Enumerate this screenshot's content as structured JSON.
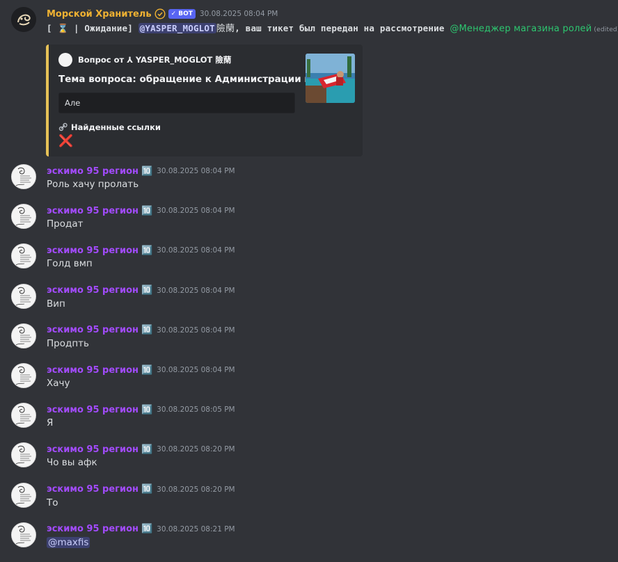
{
  "bot_message": {
    "author": "Морской Хранитель",
    "bot_tag": "BOT",
    "timestamp": "30.08.2025 08:04 PM",
    "content_prefix": "[",
    "content_emoji": "⌛",
    "content_status": " | Ожидание]",
    "user_mention": "@YASPER_MOGLOT",
    "user_suffix": "險䔵",
    "content_text": ", ваш тикет был передан на рассмотрение",
    "role_mention": "@Менеджер магазина ролей",
    "edited": "(edited)",
    "embed": {
      "author": "Вопрос от ⅄ YASPER_MOGLOT 險䔵",
      "title": "Тема вопроса: обращение к Администрации магазина",
      "field_value": "Але",
      "links_title": "Найденные ссылки",
      "links_value": "❌",
      "accent_color": "#e6c157"
    }
  },
  "user": {
    "name": "эскимо 95 регион",
    "role_icon": "🔟",
    "name_color": "#a34bff"
  },
  "messages": [
    {
      "timestamp": "30.08.2025 08:04 PM",
      "text": "Роль хачу пролать"
    },
    {
      "timestamp": "30.08.2025 08:04 PM",
      "text": "Продат"
    },
    {
      "timestamp": "30.08.2025 08:04 PM",
      "text": "Голд вмп"
    },
    {
      "timestamp": "30.08.2025 08:04 PM",
      "text": "Вип"
    },
    {
      "timestamp": "30.08.2025 08:04 PM",
      "text": "Продпть"
    },
    {
      "timestamp": "30.08.2025 08:04 PM",
      "text": "Хачу"
    },
    {
      "timestamp": "30.08.2025 08:05 PM",
      "text": "Я"
    },
    {
      "timestamp": "30.08.2025 08:20 PM",
      "text": "Чо вы афк"
    },
    {
      "timestamp": "30.08.2025 08:20 PM",
      "text": "То"
    },
    {
      "timestamp": "30.08.2025 08:21 PM",
      "mention": "@maxfis"
    }
  ],
  "theme": {
    "background": "#313338",
    "bot_name_color": "#f0b232",
    "role_mention_color": "#2dc770"
  }
}
